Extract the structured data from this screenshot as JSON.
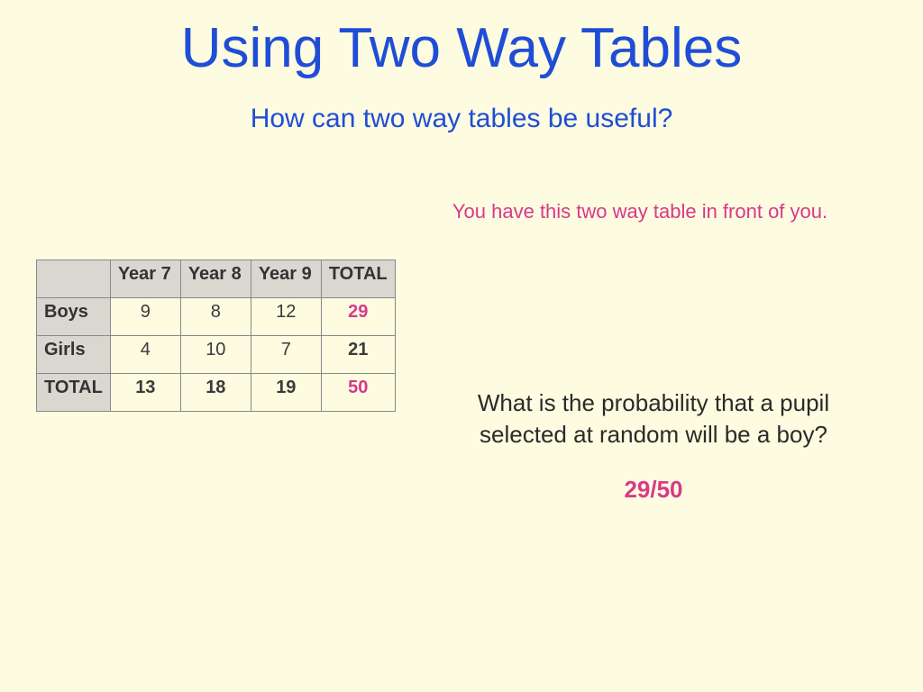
{
  "title": "Using Two Way Tables",
  "subtitle": "How can two way tables be useful?",
  "pink_note": "You have this two way table in front of you.",
  "table": {
    "blank": "",
    "col1": "Year 7",
    "col2": "Year 8",
    "col3": "Year 9",
    "col_total": "TOTAL",
    "row1_label": "Boys",
    "row1_c1": "9",
    "row1_c2": "8",
    "row1_c3": "12",
    "row1_total": "29",
    "row2_label": "Girls",
    "row2_c1": "4",
    "row2_c2": "10",
    "row2_c3": "7",
    "row2_total": "21",
    "row_total_label": "TOTAL",
    "rowt_c1": "13",
    "rowt_c2": "18",
    "rowt_c3": "19",
    "rowt_total": "50"
  },
  "question": "What is the probability that a pupil selected at random will be a boy?",
  "answer": "29/50"
}
